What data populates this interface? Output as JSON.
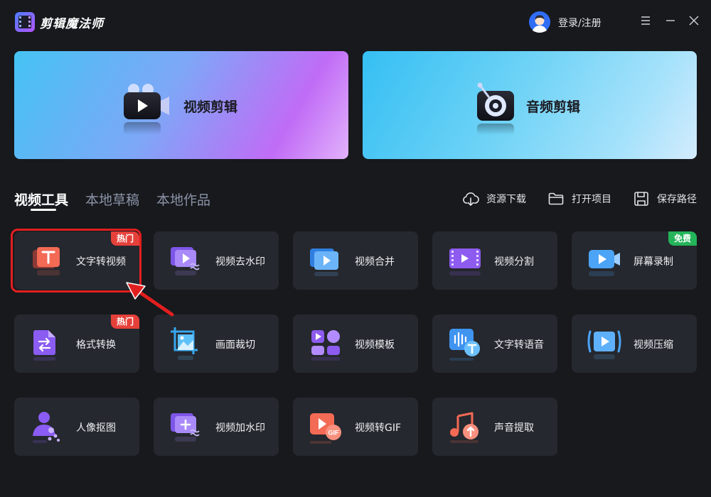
{
  "app": {
    "title": "剪辑魔法师",
    "login_label": "登录/注册"
  },
  "hero": {
    "video_label": "视频剪辑",
    "audio_label": "音频剪辑"
  },
  "tabs": [
    {
      "label": "视频工具",
      "active": true
    },
    {
      "label": "本地草稿",
      "active": false
    },
    {
      "label": "本地作品",
      "active": false
    }
  ],
  "actions": {
    "download": "资源下载",
    "open_project": "打开项目",
    "save_path": "保存路径"
  },
  "tools": [
    {
      "label": "文字转视频",
      "badge": "热门",
      "icon": "text-to-video-icon"
    },
    {
      "label": "视频去水印",
      "badge": "",
      "icon": "remove-watermark-icon"
    },
    {
      "label": "视频合并",
      "badge": "",
      "icon": "video-merge-icon"
    },
    {
      "label": "视频分割",
      "badge": "",
      "icon": "video-split-icon"
    },
    {
      "label": "屏幕录制",
      "badge": "免费",
      "icon": "screen-record-icon"
    },
    {
      "label": "格式转换",
      "badge": "热门",
      "icon": "format-convert-icon"
    },
    {
      "label": "画面裁切",
      "badge": "",
      "icon": "crop-icon"
    },
    {
      "label": "视频模板",
      "badge": "",
      "icon": "video-template-icon"
    },
    {
      "label": "文字转语音",
      "badge": "",
      "icon": "text-to-speech-icon"
    },
    {
      "label": "视频压缩",
      "badge": "",
      "icon": "video-compress-icon"
    },
    {
      "label": "人像抠图",
      "badge": "",
      "icon": "portrait-cutout-icon"
    },
    {
      "label": "视频加水印",
      "badge": "",
      "icon": "add-watermark-icon"
    },
    {
      "label": "视频转GIF",
      "badge": "",
      "icon": "video-to-gif-icon"
    },
    {
      "label": "声音提取",
      "badge": "",
      "icon": "audio-extract-icon"
    }
  ],
  "colors": {
    "background": "#17191d",
    "tile": "#25282e",
    "hot_badge": "#e6403a",
    "free_badge": "#24b45a",
    "highlight": "#e21f1f"
  }
}
